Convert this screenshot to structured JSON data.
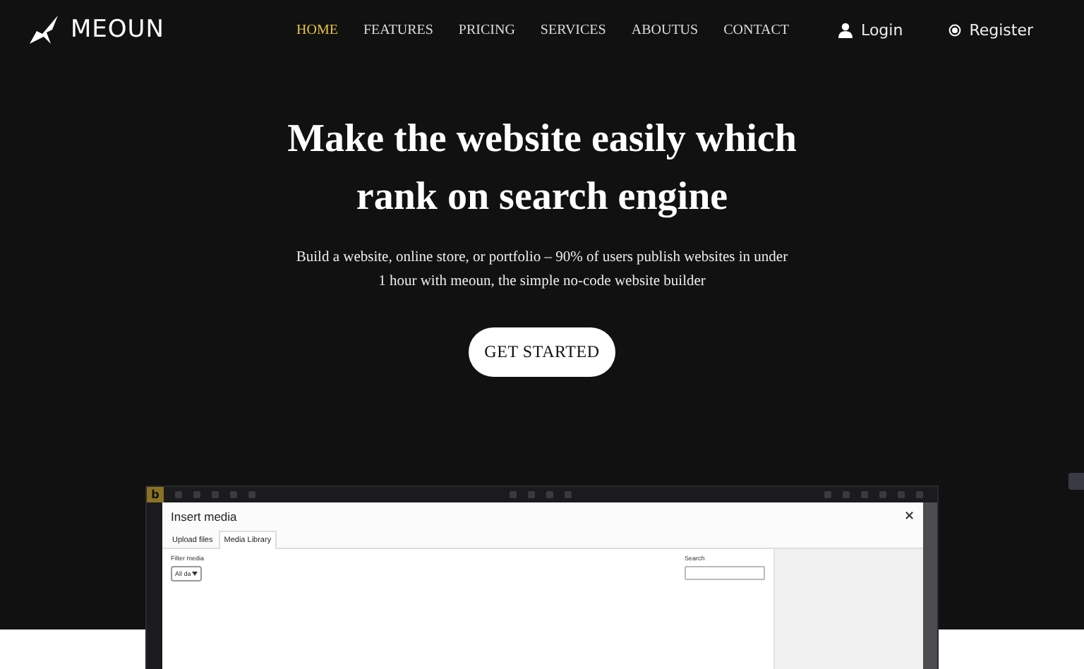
{
  "brand": {
    "name": "MEOUN"
  },
  "nav": [
    {
      "label": "HOME",
      "selected": true
    },
    {
      "label": "FEATURES",
      "selected": false
    },
    {
      "label": "PRICING",
      "selected": false
    },
    {
      "label": "SERVICES",
      "selected": false
    },
    {
      "label": "ABOUTUS",
      "selected": false
    },
    {
      "label": "CONTACT",
      "selected": false
    }
  ],
  "auth": {
    "login": "Login",
    "register": "Register"
  },
  "hero": {
    "title_lines": [
      "Make the website easily which",
      "rank on search engine"
    ],
    "subtitle_lines": [
      "Build a website, online store, or portfolio – 90% of users publish websites in under",
      "1 hour with meoun, the simple no-code website builder"
    ],
    "cta": "GET STARTED"
  },
  "preview": {
    "editor_logo": "b",
    "modal": {
      "title": "Insert media",
      "close": "×",
      "tabs": [
        {
          "label": "Upload files",
          "selected": false
        },
        {
          "label": "Media Library",
          "selected": true
        }
      ],
      "filter_label": "Filter media",
      "filter_value": "All da",
      "search_label": "Search"
    }
  }
}
